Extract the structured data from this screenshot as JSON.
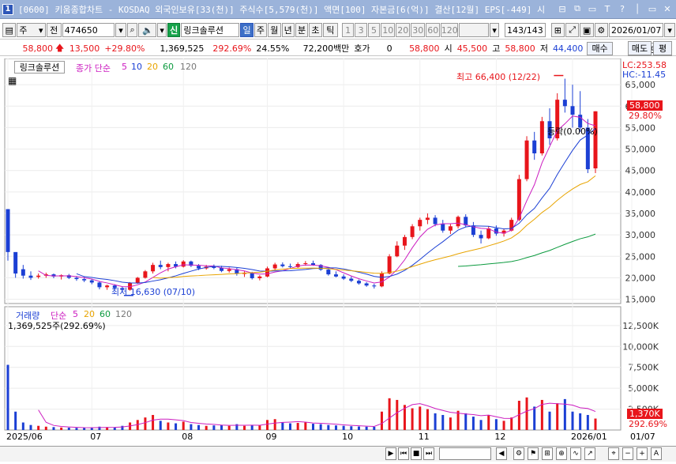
{
  "window": {
    "badge": "1",
    "title": "[0600] 키움종합차트 - KOSDAQ 외국인보유[33(천)] 주식수[5,579(천)] 액면[100] 자본금[6(억)] 결산[12월] EPS[-449] 시",
    "controls": [
      "⊟",
      "⧉",
      "▭",
      "T",
      "?",
      "│",
      "▭",
      "✕"
    ]
  },
  "toolbar": {
    "period": "주",
    "all": "전",
    "code": "474650",
    "new_badge": "신",
    "stock_name": "링크솔루션",
    "periods": [
      "일",
      "주",
      "월",
      "년",
      "분",
      "초",
      "틱"
    ],
    "intervals": [
      "1",
      "3",
      "5",
      "10",
      "20",
      "30",
      "60",
      "120"
    ],
    "count": "143/143",
    "date": "2026/01/07"
  },
  "quote": {
    "price": "58,800",
    "change": "13,500",
    "change_pct": "+29.80%",
    "volume": "1,369,525",
    "vol_pct": "292.69%",
    "turnover": "24.55%",
    "amount": "72,200백만",
    "hoga_label": "호가",
    "hoga": "0",
    "last": "58,800",
    "open_label": "시",
    "open": "45,500",
    "high_label": "고",
    "high": "58,800",
    "low_label": "저",
    "low": "44,400",
    "buy": "매수",
    "sell": "매도",
    "flat": "평"
  },
  "price_panel": {
    "stock_btn": "링크솔루션",
    "legend_label": "종가 단순",
    "ma": [
      "5",
      "10",
      "20",
      "60",
      "120"
    ],
    "lc": "LC:253.58",
    "hc": "HC:-11.45",
    "last_price": "58,800",
    "last_pct": "29.80%",
    "high_annot": "최고 66,400 (12/22)",
    "low_annot": "최저 16,630 (07/10)",
    "flat_annot": "등락(0.00%)",
    "yticks": [
      "65,000",
      "60,000",
      "55,000",
      "50,000",
      "45,000",
      "40,000",
      "35,000",
      "30,000",
      "25,000",
      "20,000",
      "15,000"
    ]
  },
  "volume_panel": {
    "legend_label": "거래량",
    "legend_simple": "단순",
    "ma": [
      "5",
      "20",
      "60",
      "120"
    ],
    "volume_text": "1,369,525주(292.69%)",
    "last_vol": "1,370K",
    "last_pct": "292.69%",
    "yticks": [
      "12,500K",
      "10,000K",
      "7,500K",
      "5,000K",
      "2,500K"
    ]
  },
  "x_axis": {
    "labels": [
      "2025/06",
      "07",
      "08",
      "09",
      "10",
      "11",
      "12",
      "2026/01",
      "01/07"
    ]
  },
  "colors": {
    "up": "#e8151b",
    "down": "#1b3fd4",
    "ma5": "#cc1dc0",
    "ma10": "#1b3fd4",
    "ma20": "#e8a400",
    "ma60": "#0b9a3e",
    "ma120": "#666666"
  },
  "chart_data": {
    "type": "candlestick",
    "periods": [
      [
        "2025/06",
        36000,
        28000,
        24000,
        26000
      ],
      [
        "2025/06",
        26000,
        24500,
        20000,
        21000
      ],
      [
        "2025/06",
        22000,
        23000,
        19800,
        20500
      ],
      [
        "2025/06",
        20500,
        21500,
        19500,
        20000
      ],
      [
        "2025/06",
        20200,
        21000,
        19800,
        20500
      ],
      [
        "2025/06",
        20500,
        21200,
        20000,
        20800
      ],
      [
        "2025/06",
        20800,
        21000,
        19900,
        20300
      ],
      [
        "2025/06",
        20300,
        20800,
        19600,
        20600
      ],
      [
        "2025/06",
        20600,
        20900,
        19700,
        20000
      ],
      [
        "2025/06",
        20000,
        20400,
        19300,
        19700
      ],
      [
        "2025/06",
        19700,
        20200,
        19000,
        19400
      ],
      [
        "07",
        19400,
        19800,
        18500,
        18900
      ],
      [
        "07",
        18900,
        19200,
        17300,
        17800
      ],
      [
        "07",
        17800,
        18400,
        17200,
        18200
      ],
      [
        "07",
        18200,
        18500,
        17400,
        17600
      ],
      [
        "07",
        17600,
        18000,
        16630,
        17200
      ],
      [
        "07",
        17200,
        19000,
        17000,
        18800
      ],
      [
        "07",
        18800,
        20200,
        18600,
        20000
      ],
      [
        "07",
        20000,
        21800,
        19800,
        21500
      ],
      [
        "07",
        21500,
        23500,
        21000,
        23000
      ],
      [
        "07",
        23000,
        24000,
        22000,
        22500
      ],
      [
        "07",
        22500,
        23500,
        21500,
        23200
      ],
      [
        "07",
        23200,
        23800,
        22200,
        22600
      ],
      [
        "08",
        22600,
        24100,
        22400,
        23800
      ],
      [
        "08",
        23800,
        24000,
        22500,
        22800
      ],
      [
        "08",
        22800,
        23200,
        21800,
        22200
      ],
      [
        "08",
        22200,
        23000,
        21900,
        22600
      ],
      [
        "08",
        22600,
        23100,
        22000,
        22300
      ],
      [
        "08",
        22300,
        22800,
        21300,
        21600
      ],
      [
        "08",
        21600,
        22400,
        21200,
        22000
      ],
      [
        "08",
        22000,
        22300,
        20500,
        20900
      ],
      [
        "08",
        20900,
        21500,
        20200,
        21200
      ],
      [
        "08",
        21200,
        21400,
        19600,
        19900
      ],
      [
        "08",
        19900,
        20600,
        19400,
        20300
      ],
      [
        "09",
        20300,
        22600,
        20100,
        22200
      ],
      [
        "09",
        22200,
        23500,
        21800,
        23100
      ],
      [
        "09",
        23100,
        23600,
        22400,
        22700
      ],
      [
        "09",
        22700,
        23300,
        22200,
        22500
      ],
      [
        "09",
        22500,
        23600,
        22300,
        23200
      ],
      [
        "09",
        23200,
        23900,
        22800,
        23400
      ],
      [
        "09",
        23400,
        24000,
        22800,
        23000
      ],
      [
        "09",
        23000,
        23200,
        21600,
        21900
      ],
      [
        "09",
        21900,
        22200,
        20500,
        20800
      ],
      [
        "09",
        20800,
        21500,
        20100,
        20300
      ],
      [
        "10",
        20300,
        20800,
        19500,
        19800
      ],
      [
        "10",
        19800,
        20300,
        19000,
        19300
      ],
      [
        "10",
        19300,
        19600,
        18400,
        18700
      ],
      [
        "10",
        18700,
        19000,
        17900,
        18200
      ],
      [
        "10",
        18200,
        18600,
        17500,
        18000
      ],
      [
        "10",
        18000,
        21500,
        17800,
        21000
      ],
      [
        "10",
        21000,
        25500,
        20800,
        25000
      ],
      [
        "10",
        25000,
        28500,
        24800,
        27500
      ],
      [
        "10",
        27500,
        30000,
        26500,
        29500
      ],
      [
        "10",
        29500,
        32500,
        29000,
        32000
      ],
      [
        "11",
        32000,
        34000,
        31000,
        33500
      ],
      [
        "11",
        33500,
        35000,
        32500,
        34000
      ],
      [
        "11",
        34000,
        34600,
        32000,
        32500
      ],
      [
        "11",
        32500,
        33500,
        30500,
        31000
      ],
      [
        "11",
        31000,
        32500,
        30200,
        32000
      ],
      [
        "11",
        32000,
        34500,
        31500,
        34200
      ],
      [
        "11",
        34200,
        34800,
        31800,
        32200
      ],
      [
        "11",
        32200,
        33000,
        29500,
        30000
      ],
      [
        "11",
        30000,
        31000,
        28000,
        29200
      ],
      [
        "11",
        29200,
        32000,
        29000,
        31500
      ],
      [
        "12",
        31500,
        32200,
        29800,
        30300
      ],
      [
        "12",
        30300,
        31500,
        29600,
        31000
      ],
      [
        "12",
        31000,
        34000,
        30800,
        33500
      ],
      [
        "12",
        33500,
        44000,
        33200,
        43000
      ],
      [
        "12",
        43000,
        53000,
        42500,
        52000
      ],
      [
        "12",
        52000,
        54000,
        47500,
        49000
      ],
      [
        "12",
        49000,
        57500,
        48500,
        56500
      ],
      [
        "12",
        56500,
        59500,
        51000,
        52500
      ],
      [
        "12",
        52500,
        63000,
        52000,
        61500
      ],
      [
        "12",
        61500,
        66400,
        58500,
        60000
      ],
      [
        "2026/01",
        60000,
        65000,
        55000,
        58000
      ],
      [
        "2026/01",
        58000,
        63500,
        54000,
        55000
      ],
      [
        "2026/01",
        55000,
        57000,
        44400,
        45300
      ],
      [
        "2026/01",
        45500,
        58800,
        44400,
        58800
      ]
    ],
    "volume": [
      7800,
      2200,
      900,
      600,
      500,
      400,
      350,
      300,
      280,
      260,
      240,
      300,
      400,
      350,
      300,
      500,
      900,
      1200,
      1500,
      1800,
      1100,
      900,
      800,
      1000,
      700,
      600,
      500,
      550,
      600,
      500,
      700,
      500,
      600,
      550,
      1200,
      1300,
      900,
      800,
      850,
      900,
      750,
      700,
      600,
      550,
      500,
      450,
      420,
      400,
      380,
      2200,
      3800,
      3600,
      3000,
      2600,
      2800,
      2500,
      2000,
      1800,
      1500,
      2300,
      2000,
      1600,
      1200,
      1800,
      1300,
      1100,
      1500,
      3500,
      3900,
      2800,
      3600,
      2200,
      3200,
      3700,
      2200,
      2000,
      1800,
      1370
    ],
    "ylim": [
      14000,
      70000
    ],
    "vol_ylim": [
      0,
      14000
    ]
  }
}
